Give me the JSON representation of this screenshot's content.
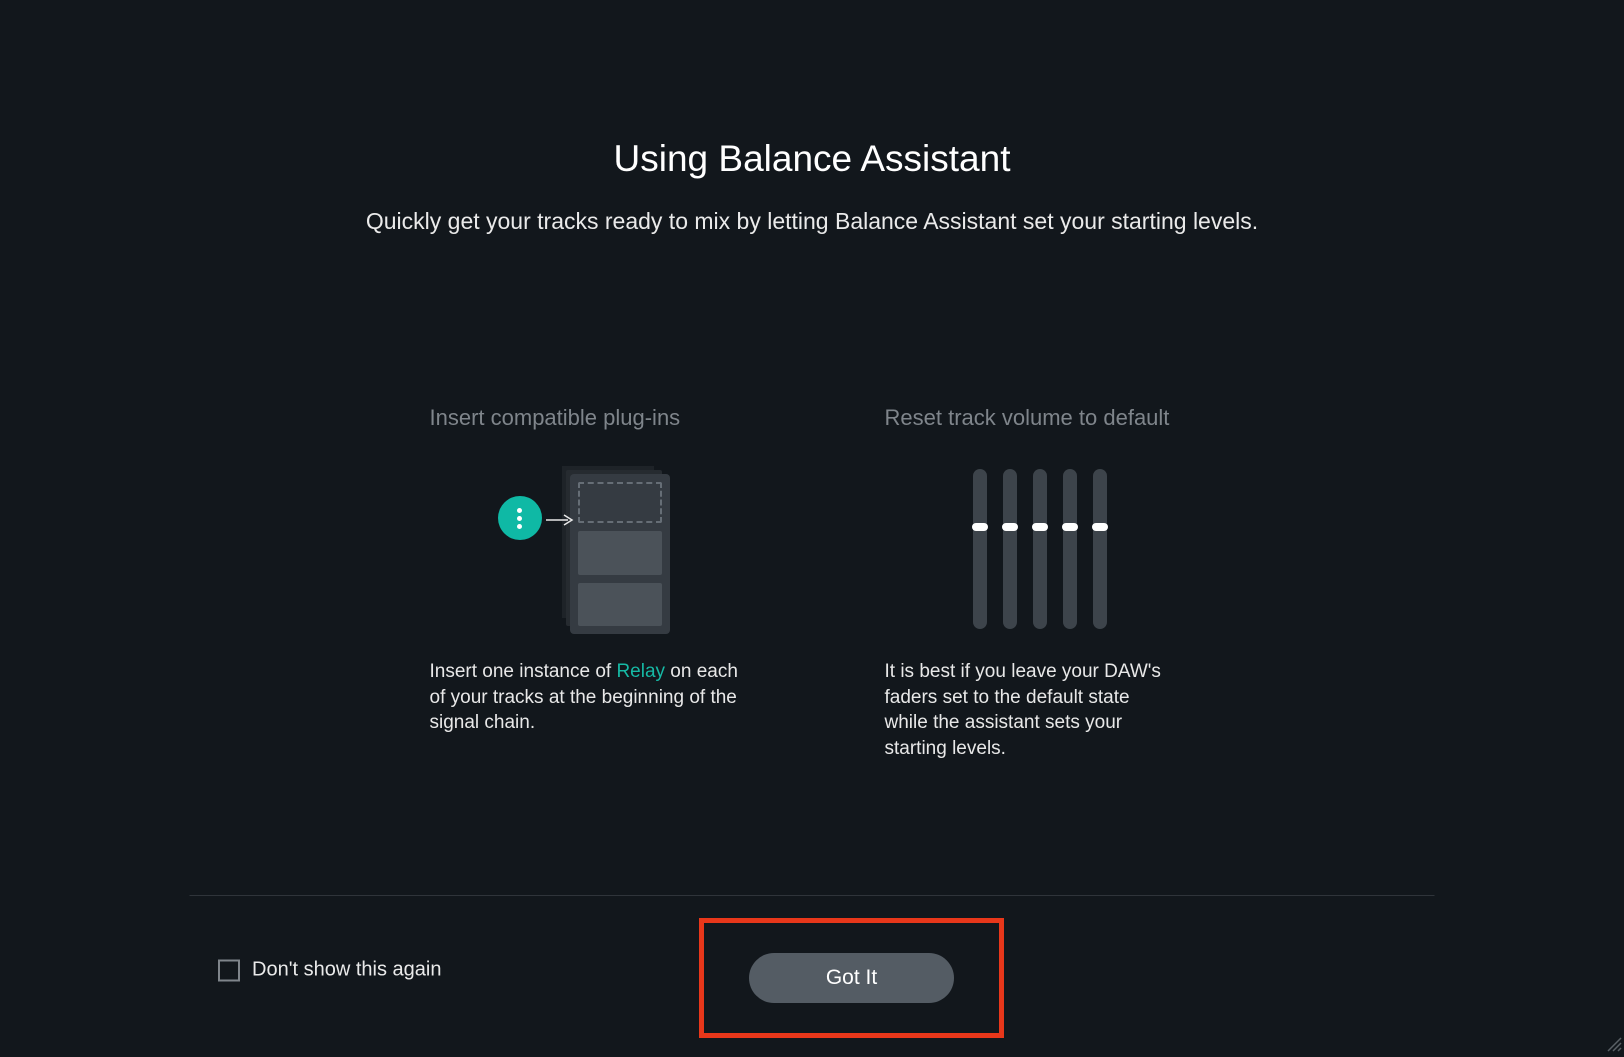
{
  "header": {
    "title": "Using Balance Assistant",
    "subtitle": "Quickly get your tracks ready to mix by letting Balance Assistant set your starting levels."
  },
  "steps": {
    "insert": {
      "title": "Insert compatible plug-ins",
      "desc_pre": "Insert one instance of ",
      "desc_link": "Relay",
      "desc_post": " on each of your tracks at the beginning of the signal chain."
    },
    "reset": {
      "title": "Reset track volume to default",
      "desc": "It is best if you leave your DAW's faders set to the default state while the assistant sets your starting levels."
    }
  },
  "footer": {
    "checkbox_label": "Don't show this again",
    "button_label": "Got It"
  },
  "colors": {
    "accent": "#0fb9a5",
    "highlight_box": "#e8371a",
    "background": "#12171c"
  }
}
